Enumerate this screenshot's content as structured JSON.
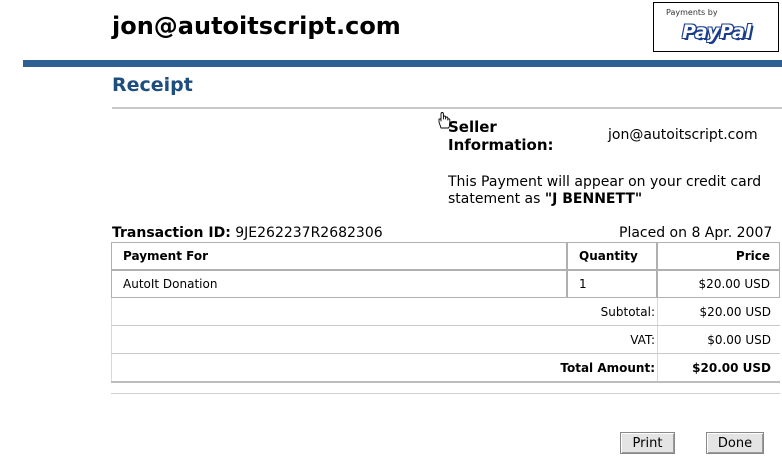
{
  "header": {
    "merchant_email": "jon@autoitscript.com",
    "payments_by": "Payments by",
    "paypal_logo": "PayPal"
  },
  "receipt": {
    "title": "Receipt",
    "seller_label": "Seller Information:",
    "seller_email": "jon@autoitscript.com",
    "statement_prefix": "This Payment will appear on your credit card statement as ",
    "statement_name": "\"J BENNETT\"",
    "transaction_label": "Transaction ID:",
    "transaction_id": "9JE262237R2682306",
    "placed_on": "Placed on 8 Apr. 2007"
  },
  "table": {
    "headers": {
      "payment_for": "Payment For",
      "quantity": "Quantity",
      "price": "Price"
    },
    "items": [
      {
        "payment_for": "AutoIt Donation",
        "quantity": "1",
        "price": "$20.00 USD"
      }
    ],
    "subtotal_label": "Subtotal:",
    "subtotal_value": "$20.00 USD",
    "vat_label": "VAT:",
    "vat_value": "$0.00 USD",
    "total_label": "Total Amount:",
    "total_value": "$20.00 USD"
  },
  "buttons": {
    "print": "Print",
    "done": "Done"
  },
  "colors": {
    "accent_bar": "#2f5f95",
    "title": "#1d4e7e"
  },
  "icons": {
    "cursor": "hand-pointer-icon"
  }
}
